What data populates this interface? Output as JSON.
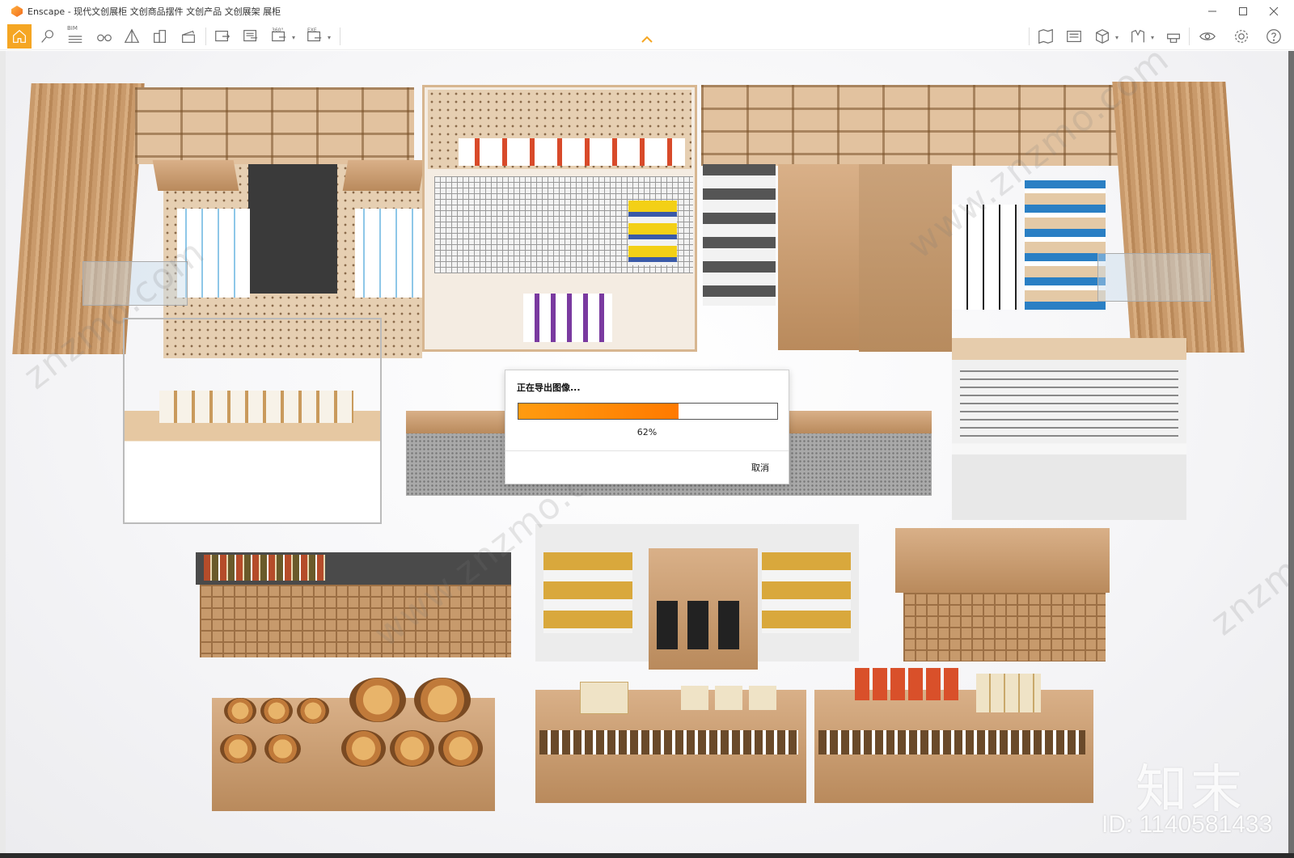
{
  "window": {
    "app_name": "Enscape",
    "title": "Enscape - 现代文创展柜 文创商品摆件 文创产品 文创展架 展柜",
    "controls": [
      "minimize-icon",
      "maximize-icon",
      "close-icon"
    ]
  },
  "toolbar": {
    "left_icons": [
      "home-icon",
      "location-pin-icon",
      "bim-icon",
      "binoculars-icon",
      "perspective-icon",
      "buildings-icon",
      "clapboard-icon",
      "render-image-icon",
      "batch-render-icon",
      "panorama-icon",
      "export-exe-icon"
    ],
    "bim_label": "BIM",
    "panorama_label": "360°",
    "exe_label": "EXE",
    "right_icons": [
      "map-icon",
      "asset-library-icon",
      "cube-icon",
      "material-icon",
      "vr-headset-icon",
      "visual-settings-icon",
      "settings-icon",
      "help-icon"
    ]
  },
  "dialog": {
    "title": "正在导出图像...",
    "progress": 0.62,
    "progress_text": "62%",
    "cancel_label": "取消"
  },
  "watermark": {
    "brand": "知末",
    "id_text": "ID: 1140581433"
  },
  "colors": {
    "accent": "#f5a623",
    "progress": "#ff8a00"
  }
}
